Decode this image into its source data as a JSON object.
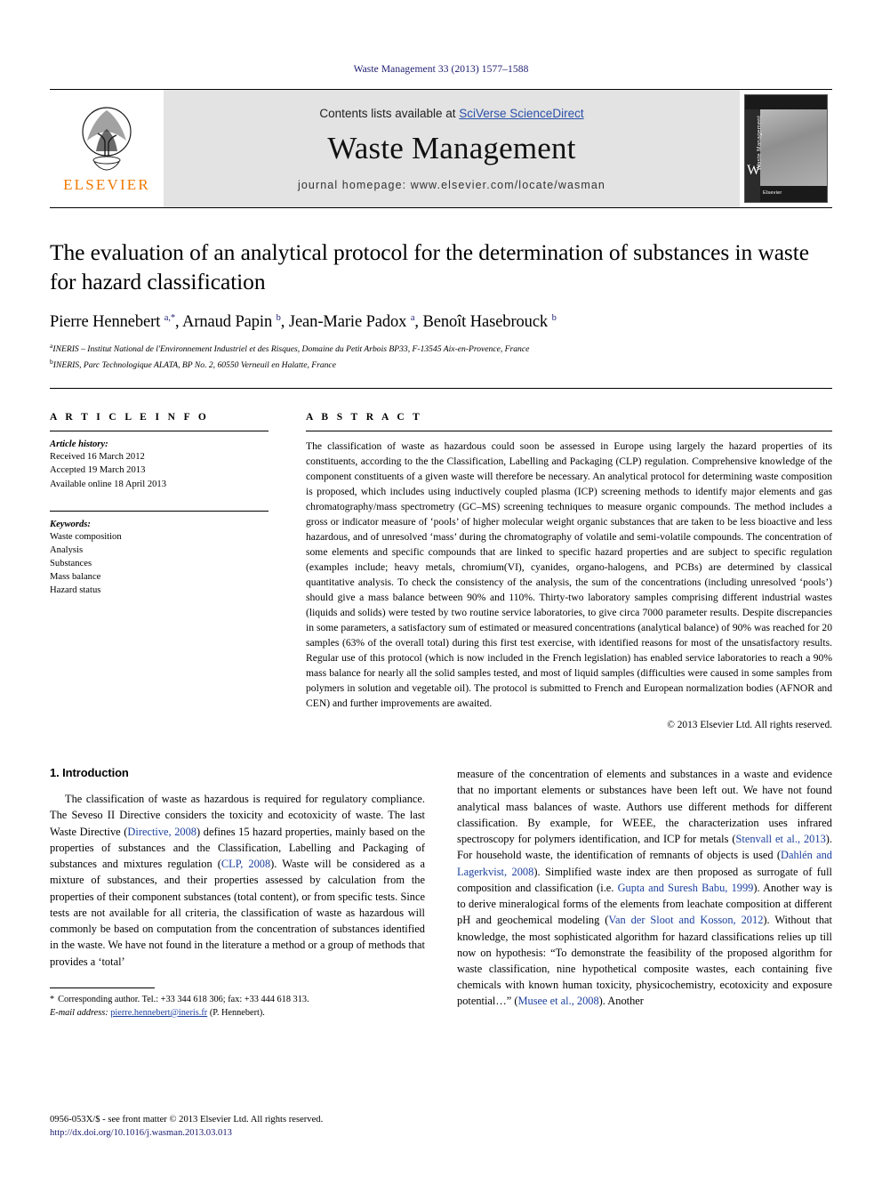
{
  "running_head": "Waste Management 33 (2013) 1577–1588",
  "masthead": {
    "publisher_name": "ELSEVIER",
    "contents_prefix": "Contents lists available at ",
    "contents_link": "SciVerse ScienceDirect",
    "journal_title": "Waste Management",
    "homepage": "journal homepage: www.elsevier.com/locate/wasman",
    "cover_vertical_text": "Waste Management",
    "cover_badge": "W",
    "cover_bottom_text": "Elsevier"
  },
  "article": {
    "title": "The evaluation of an analytical protocol for the determination of substances in waste for hazard classification",
    "authors_html": "Pierre Hennebert <sup>a,*</sup>, Arnaud Papin <sup>b</sup>, Jean-Marie Padox <sup>a</sup>, Benoît Hasebrouck <sup>b</sup>",
    "affiliations": [
      "INERIS – Institut National de l'Environnement Industriel et des Risques, Domaine du Petit Arbois BP33, F-13545 Aix-en-Provence, France",
      "INERIS, Parc Technologique ALATA, BP No. 2, 60550 Verneuil en Halatte, France"
    ],
    "affiliation_marks": [
      "a",
      "b"
    ]
  },
  "article_info": {
    "section_label": "A R T I C L E    I N F O",
    "history_heading": "Article history:",
    "history": [
      "Received 16 March 2012",
      "Accepted 19 March 2013",
      "Available online 18 April 2013"
    ],
    "keywords_heading": "Keywords:",
    "keywords": [
      "Waste composition",
      "Analysis",
      "Substances",
      "Mass balance",
      "Hazard status"
    ]
  },
  "abstract": {
    "section_label": "A B S T R A C T",
    "text": "The classification of waste as hazardous could soon be assessed in Europe using largely the hazard properties of its constituents, according to the the Classification, Labelling and Packaging (CLP) regulation. Comprehensive knowledge of the component constituents of a given waste will therefore be necessary. An analytical protocol for determining waste composition is proposed, which includes using inductively coupled plasma (ICP) screening methods to identify major elements and gas chromatography/mass spectrometry (GC–MS) screening techniques to measure organic compounds. The method includes a gross or indicator measure of ‘pools’ of higher molecular weight organic substances that are taken to be less bioactive and less hazardous, and of unresolved ‘mass’ during the chromatography of volatile and semi-volatile compounds. The concentration of some elements and specific compounds that are linked to specific hazard properties and are subject to specific regulation (examples include; heavy metals, chromium(VI), cyanides, organo-halogens, and PCBs) are determined by classical quantitative analysis. To check the consistency of the analysis, the sum of the concentrations (including unresolved ‘pools’) should give a mass balance between 90% and 110%. Thirty-two laboratory samples comprising different industrial wastes (liquids and solids) were tested by two routine service laboratories, to give circa 7000 parameter results. Despite discrepancies in some parameters, a satisfactory sum of estimated or measured concentrations (analytical balance) of 90% was reached for 20 samples (63% of the overall total) during this first test exercise, with identified reasons for most of the unsatisfactory results. Regular use of this protocol (which is now included in the French legislation) has enabled service laboratories to reach a 90% mass balance for nearly all the solid samples tested, and most of liquid samples (difficulties were caused in some samples from polymers in solution and vegetable oil). The protocol is submitted to French and European normalization bodies (AFNOR and CEN) and further improvements are awaited.",
    "copyright": "© 2013 Elsevier Ltd. All rights reserved."
  },
  "introduction": {
    "heading": "1. Introduction",
    "left_paragraph_html": "The classification of waste as hazardous is required for regulatory compliance. The Seveso II Directive considers the toxicity and ecotoxicity of waste. The last Waste Directive (<span class=\"ref\">Directive, 2008</span>) defines 15 hazard properties, mainly based on the properties of substances and the Classification, Labelling and Packaging of substances and mixtures regulation (<span class=\"ref\">CLP, 2008</span>). Waste will be considered as a mixture of substances, and their properties assessed by calculation from the properties of their component substances (total content), or from specific tests. Since tests are not available for all criteria, the classification of waste as hazardous will commonly be based on computation from the concentration of substances identified in the waste. We have not found in the literature a method or a group of methods that provides a ‘total’",
    "right_paragraph_html": "measure of the concentration of elements and substances in a waste and evidence that no important elements or substances have been left out. We have not found analytical mass balances of waste. Authors use different methods for different classification. By example, for WEEE, the characterization uses infrared spectroscopy for polymers identification, and ICP for metals (<span class=\"ref\">Stenvall et al., 2013</span>). For household waste, the identification of remnants of objects is used (<span class=\"ref\">Dahlén and Lagerkvist, 2008</span>). Simplified waste index are then proposed as surrogate of full composition and classification (i.e. <span class=\"ref\">Gupta and Suresh Babu, 1999</span>). Another way is to derive mineralogical forms of the elements from leachate composition at different pH and geochemical modeling (<span class=\"ref\">Van der Sloot and Kosson, 2012</span>). Without that knowledge, the most sophisticated algorithm for hazard classifications relies up till now on hypothesis: “To demonstrate the feasibility of the proposed algorithm for waste classification, nine hypothetical composite wastes, each containing five chemicals with known human toxicity, physicochemistry, ecotoxicity and exposure potential…” (<span class=\"ref\">Musee et al., 2008</span>). Another"
  },
  "footnote": {
    "corresponding_author": "Corresponding author. Tel.: +33 344 618 306; fax: +33 444 618 313.",
    "email_label": "E-mail address:",
    "email": "pierre.hennebert@ineris.fr",
    "email_owner": "(P. Hennebert)."
  },
  "page_footer": {
    "issn_line": "0956-053X/$ - see front matter © 2013 Elsevier Ltd. All rights reserved.",
    "doi_line": "http://dx.doi.org/10.1016/j.wasman.2013.03.013"
  }
}
